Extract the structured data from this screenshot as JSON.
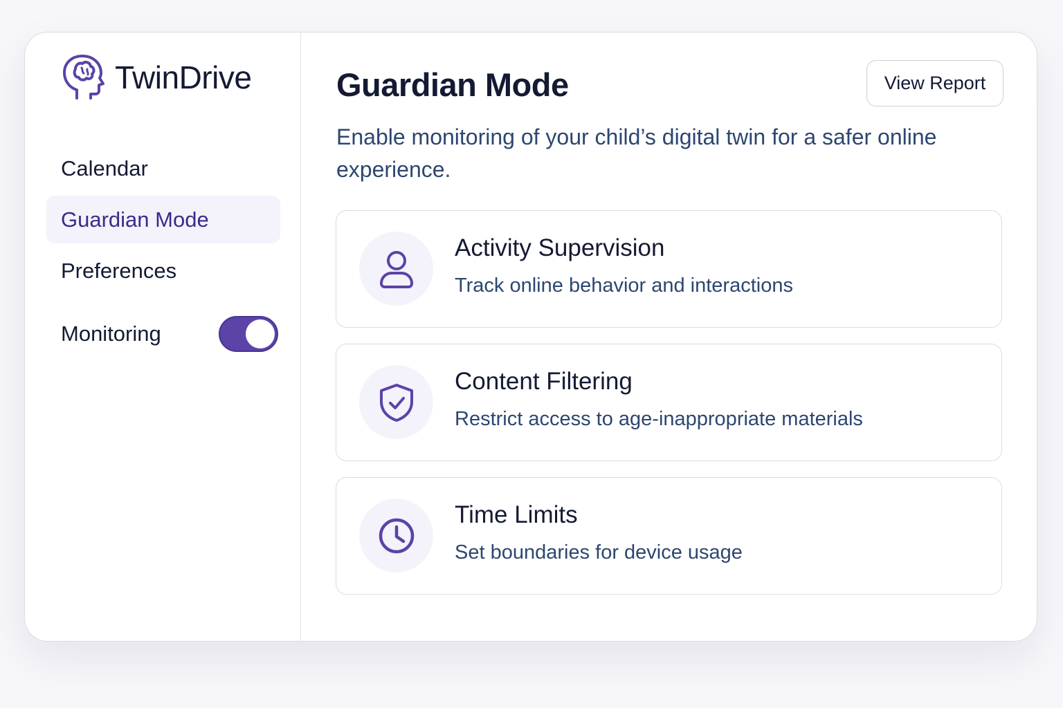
{
  "app": {
    "name": "TwinDrive",
    "logo_icon": "brain-head-icon"
  },
  "sidebar": {
    "items": [
      {
        "label": "Calendar",
        "active": false
      },
      {
        "label": "Guardian Mode",
        "active": true
      },
      {
        "label": "Preferences",
        "active": false
      }
    ],
    "monitoring": {
      "label": "Monitoring",
      "enabled": true
    }
  },
  "main": {
    "title": "Guardian Mode",
    "report_button": "View Report",
    "subtitle": "Enable monitoring of your child’s digital twin for a safer online experience.",
    "cards": [
      {
        "title": "Activity Supervision",
        "description": "Track online behavior and interactions",
        "icon": "user-icon"
      },
      {
        "title": "Content Filtering",
        "description": "Restrict access to age-inappropriate materials",
        "icon": "shield-check-icon"
      },
      {
        "title": "Time Limits",
        "description": "Set boundaries for device usage",
        "icon": "clock-icon"
      }
    ]
  },
  "colors": {
    "accent": "#5b43a8",
    "text_primary": "#141a33",
    "text_secondary": "#2d4670",
    "active_bg": "#f4f2fb"
  }
}
